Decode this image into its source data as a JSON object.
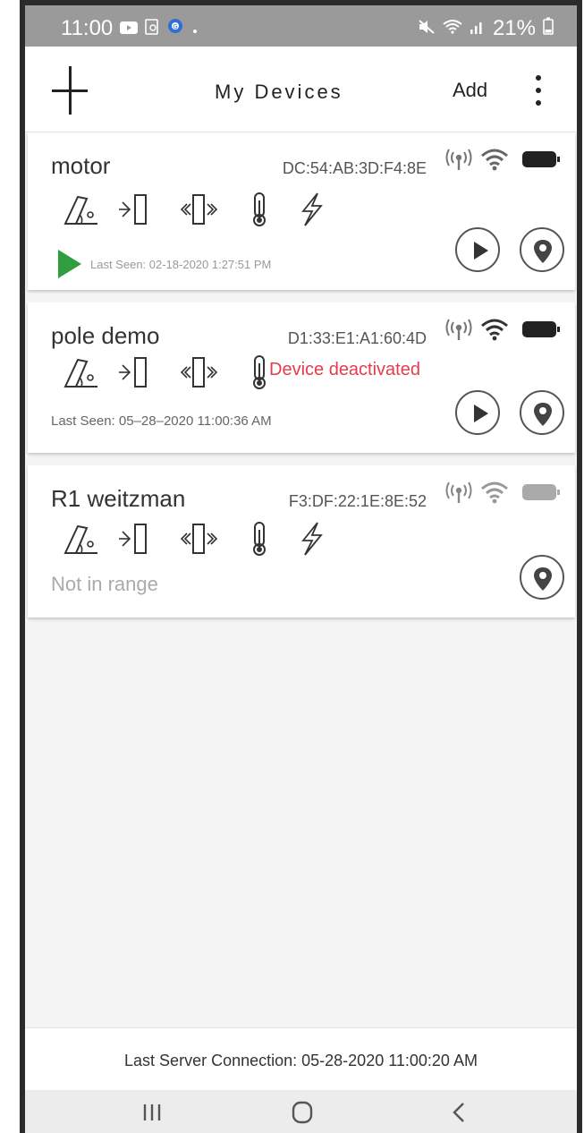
{
  "status_bar": {
    "time": "11:00",
    "battery_percent": "21%",
    "left_icons": [
      "youtube-icon",
      "screenshot-icon",
      "settings-app-icon",
      "dot-icon"
    ],
    "right_icons": [
      "mute-icon",
      "wifi-icon",
      "signal-bars-icon",
      "battery-icon"
    ]
  },
  "app_bar": {
    "title": "My Devices",
    "add_label": "Add",
    "menu_icon": "plus-crosshair-icon",
    "overflow_icon": "more-vert-icon"
  },
  "devices": [
    {
      "name": "motor",
      "mac": "DC:54:AB:3D:F4:8E",
      "sensors": [
        "tilt-icon",
        "proximity-icon",
        "vibration-icon",
        "thermometer-icon",
        "lightning-icon"
      ],
      "last_seen": "Last Seen: 02-18-2020 1:27:51 PM",
      "status_text": "",
      "actions": [
        "play-button",
        "location-button"
      ]
    },
    {
      "name": "pole demo",
      "mac": "D1:33:E1:A1:60:4D",
      "sensors": [
        "tilt-icon",
        "proximity-icon",
        "vibration-icon",
        "thermometer-icon"
      ],
      "last_seen": "Last Seen: 05–28–2020 11:00:36 AM",
      "status_text": "Device deactivated",
      "actions": [
        "play-button",
        "location-button"
      ]
    },
    {
      "name": "R1 weitzman",
      "mac": "F3:DF:22:1E:8E:52",
      "sensors": [
        "tilt-icon",
        "proximity-icon",
        "vibration-icon",
        "thermometer-icon",
        "lightning-icon"
      ],
      "last_seen": "",
      "status_text": "Not in range",
      "actions": [
        "location-button"
      ]
    }
  ],
  "footer": {
    "server_connection": "Last Server Connection: 05-28-2020 11:00:20 AM"
  },
  "colors": {
    "accent_green": "#2e9e3e",
    "deactivated_red": "#e53c4c",
    "status_bar": "#9a9a9a"
  }
}
